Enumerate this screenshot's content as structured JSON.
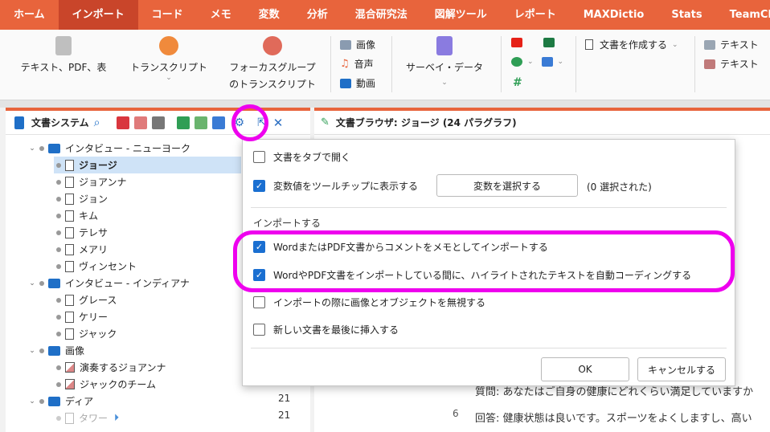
{
  "menu": [
    "ホーム",
    "インポート",
    "コード",
    "メモ",
    "変数",
    "分析",
    "混合研究法",
    "図解ツール",
    "レポート",
    "MAXDictio",
    "Stats",
    "TeamClou"
  ],
  "ribbon": {
    "text_pdf": "テキスト、PDF、表",
    "transcript": "トランスクリプト",
    "focus_group_1": "フォーカスグループ",
    "focus_group_2": "のトランスクリプト",
    "image": "画像",
    "audio": "音声",
    "video": "動画",
    "survey": "サーベイ・データ",
    "create_doc": "文書を作成する",
    "text_a": "テキスト",
    "text_b": "テキスト"
  },
  "left_panel": {
    "title": "文書システム",
    "tree": [
      {
        "label": "インタビュー - ニューヨーク",
        "type": "folder"
      },
      {
        "label": "ジョージ",
        "type": "doc",
        "selected": true
      },
      {
        "label": "ジョアンナ",
        "type": "doc"
      },
      {
        "label": "ジョン",
        "type": "doc"
      },
      {
        "label": "キム",
        "type": "doc"
      },
      {
        "label": "テレサ",
        "type": "doc"
      },
      {
        "label": "メアリ",
        "type": "doc"
      },
      {
        "label": "ヴィンセント",
        "type": "doc"
      },
      {
        "label": "インタビュー - インディアナ",
        "type": "folder"
      },
      {
        "label": "グレース",
        "type": "doc"
      },
      {
        "label": "ケリー",
        "type": "doc"
      },
      {
        "label": "ジャック",
        "type": "doc"
      },
      {
        "label": "画像",
        "type": "folder"
      },
      {
        "label": "演奏するジョアンナ",
        "type": "img"
      },
      {
        "label": "ジャックのチーム",
        "type": "img"
      },
      {
        "label": "ディア",
        "type": "folder"
      },
      {
        "label": "タワー",
        "type": "doc"
      }
    ],
    "numbers": [
      "21",
      "21"
    ]
  },
  "right_panel": {
    "title": "文書ブラウザ: ジョージ  (24 パラグラフ)",
    "para_num": "6",
    "line1": "質問: あなたはご自身の健康にどれくらい満足していますか",
    "line2": "回答: 健康状態は良いです。スポーツをよくしますし、高い"
  },
  "dialog": {
    "opt_tabs": "文書をタブで開く",
    "opt_tooltip": "変数値をツールチップに表示する",
    "select_var_btn": "変数を選択する",
    "selected_count": "(0 選択された)",
    "section_import": "インポートする",
    "opt_comments": "WordまたはPDF文書からコメントをメモとしてインポートする",
    "opt_autocode": "WordやPDF文書をインポートしている間に、ハイライトされたテキストを自動コーディングする",
    "opt_ignore_img": "インポートの際に画像とオブジェクトを無視する",
    "opt_insert_last": "新しい文書を最後に挿入する",
    "ok": "OK",
    "cancel": "キャンセルする"
  },
  "colors": {
    "accent": "#e8643c",
    "highlight": "#ee00ee",
    "checkbox": "#1a6fd1"
  }
}
